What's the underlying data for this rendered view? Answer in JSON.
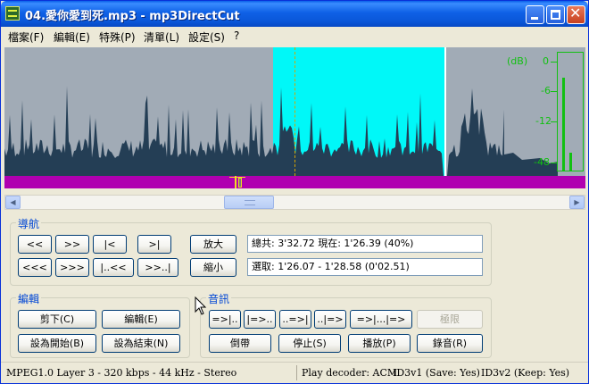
{
  "window": {
    "title": "04.愛你愛到死.mp3 - mp3DirectCut"
  },
  "menu": [
    "檔案(F)",
    "編輯(E)",
    "特殊(P)",
    "清單(L)",
    "設定(S)",
    "?"
  ],
  "vu_meter": {
    "unit_label": "(dB)",
    "labels": [
      "0",
      "-6",
      "-12",
      "-48"
    ],
    "color": "#12c012"
  },
  "waveform": {
    "selection_color": "#00f8f8",
    "wave_color": "#243e55",
    "background_color": "#a1abb6",
    "marker_color": "#b000b0"
  },
  "nav": {
    "title": "導航",
    "row1": [
      "<<",
      ">>",
      "|<",
      ">|"
    ],
    "row2": [
      "<<<",
      ">>>",
      "|..<<",
      ">>..|"
    ],
    "zoom_in": "放大",
    "zoom_out": "縮小",
    "total_info": "總共: 3'32.72   現在: 1'26.39   (40%)",
    "selection_info": "選取: 1'26.07 - 1'28.58 (0'02.51)"
  },
  "edit": {
    "title": "編輯",
    "cut": "剪下(C)",
    "edit": "編輯(E)",
    "set_start": "設為開始(B)",
    "set_end": "設為結束(N)"
  },
  "audio": {
    "title": "音訊",
    "row1": [
      "=>|..",
      "|=>..",
      "..=>|",
      "..|=>",
      "=>|...|=>"
    ],
    "limit": "極限",
    "rewind": "倒帶",
    "stop": "停止(S)",
    "play": "播放(P)",
    "record": "錄音(R)"
  },
  "status": {
    "format": "MPEG1.0 Layer 3 - 320 kbps - 44 kHz - Stereo",
    "decoder": "Play decoder: ACM",
    "id3v1": "ID3v1 (Save: Yes)",
    "id3v2": "ID3v2 (Keep: Yes)"
  }
}
